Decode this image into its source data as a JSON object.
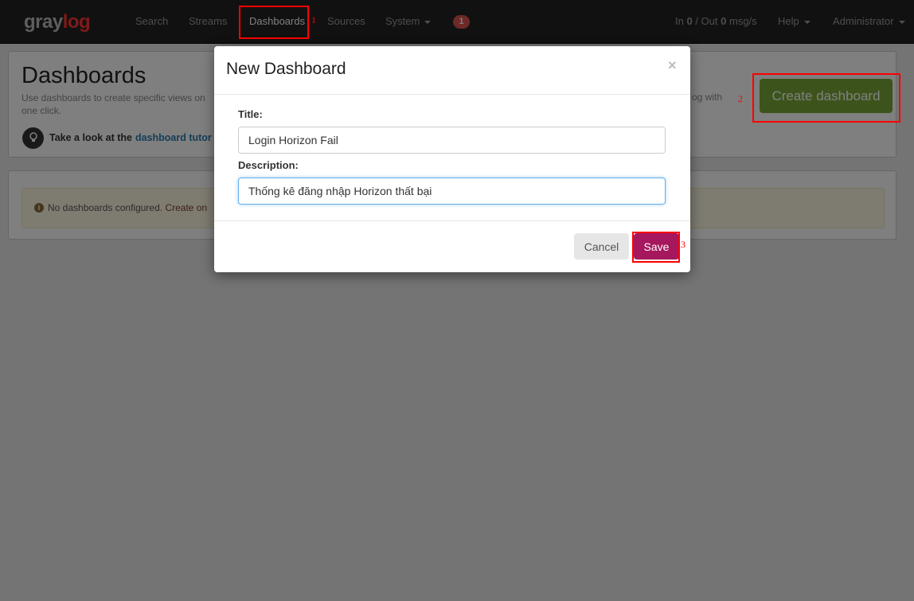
{
  "navbar": {
    "logo_gray": "gray",
    "logo_log": "log",
    "items": [
      {
        "label": "Search"
      },
      {
        "label": "Streams"
      },
      {
        "label": "Dashboards"
      },
      {
        "label": "Sources"
      },
      {
        "label": "System"
      }
    ],
    "notification_count": "1",
    "throughput": {
      "in_label": "In",
      "in_value": "0",
      "out_label": "/ Out",
      "out_value": "0",
      "unit": "msg/s"
    },
    "help_label": "Help",
    "user_label": "Administrator"
  },
  "page": {
    "title": "Dashboards",
    "description": "Use dashboards to create specific views on",
    "description_right": "og with",
    "description_line2": "one click.",
    "tutorial_prefix": "Take a look at the",
    "tutorial_link": "dashboard tutor",
    "create_button": "Create dashboard",
    "empty_message": "No dashboards configured.",
    "empty_link": "Create on"
  },
  "modal": {
    "title": "New Dashboard",
    "close_glyph": "×",
    "title_label": "Title:",
    "title_value": "Login Horizon Fail",
    "description_label": "Description:",
    "description_value": "Thống kê đăng nhập Horizon thất bại",
    "cancel_label": "Cancel",
    "save_label": "Save"
  },
  "annotations": {
    "step1": "1",
    "step2": "2",
    "step3": "3"
  },
  "colors": {
    "brand_red": "#ff3633",
    "create_green": "#79a937",
    "save_magenta": "#a6175d",
    "annotation_red": "#ff0000"
  }
}
